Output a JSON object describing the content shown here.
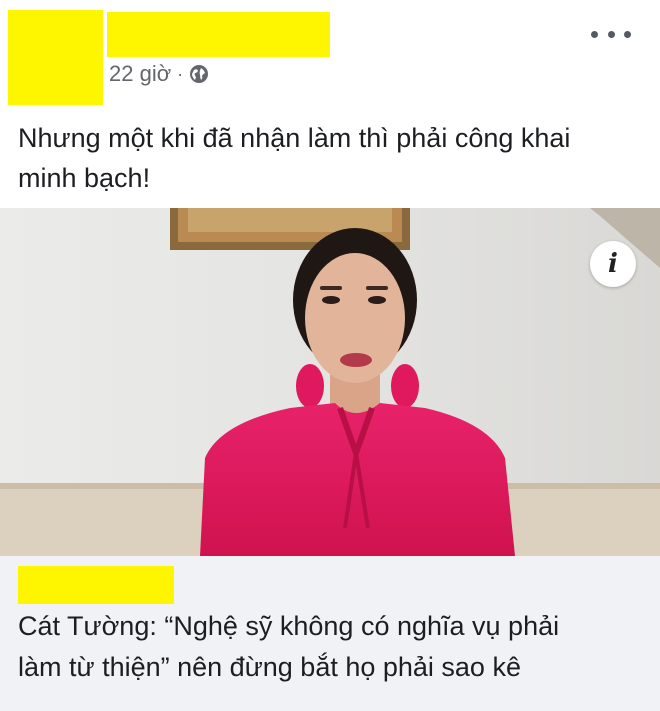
{
  "post": {
    "timestamp": "22 giờ",
    "separator": "·",
    "privacy_icon": "globe-icon",
    "menu_icon": "more-options-icon",
    "text_line1": "Nhưng một khi đã nhận làm thì phải công khai",
    "text_line2": "minh bạch!"
  },
  "link_preview": {
    "info_label": "i",
    "headline_line1": "Cát Tường: “Nghệ sỹ không có nghĩa vụ phải",
    "headline_line2": "làm từ thiện” nên đừng bắt họ phải sao kê"
  },
  "colors": {
    "redaction": "#fdf600",
    "footer_bg": "#f0f2f5",
    "dress": "#e0195f"
  }
}
